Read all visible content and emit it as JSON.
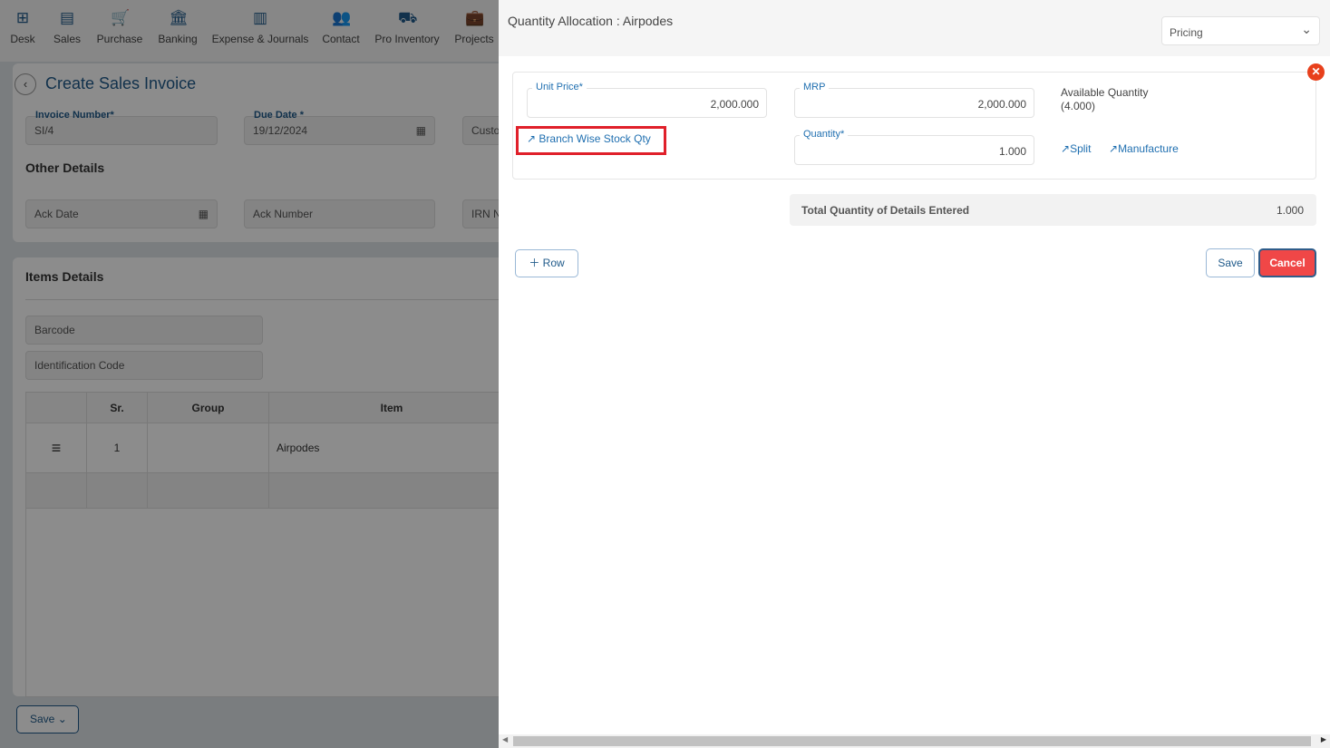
{
  "nav": [
    {
      "label": "Desk",
      "icon": "grid-plus-icon"
    },
    {
      "label": "Sales",
      "icon": "receipt-icon"
    },
    {
      "label": "Purchase",
      "icon": "cart-icon"
    },
    {
      "label": "Banking",
      "icon": "bank-icon"
    },
    {
      "label": "Expense & Journals",
      "icon": "journal-icon"
    },
    {
      "label": "Contact",
      "icon": "contacts-icon"
    },
    {
      "label": "Pro Inventory",
      "icon": "inventory-icon"
    },
    {
      "label": "Projects",
      "icon": "projects-icon"
    }
  ],
  "page": {
    "title": "Create Sales Invoice",
    "invoice_number_label": "Invoice Number*",
    "invoice_number": "SI/4",
    "due_date_label": "Due Date *",
    "due_date": "19/12/2024",
    "customer_placeholder": "Custo",
    "other_details": "Other Details",
    "ack_date": "Ack Date",
    "ack_number": "Ack Number",
    "irn": "IRN N",
    "items_details": "Items Details",
    "barcode": "Barcode",
    "identification_code": "Identification Code",
    "table": {
      "headers": [
        "",
        "Sr.",
        "Group",
        "Item"
      ],
      "rows": [
        {
          "sr": "1",
          "group": "",
          "item": "Airpodes"
        }
      ]
    },
    "save": "Save"
  },
  "panel": {
    "title": "Quantity Allocation : Airpodes",
    "select": "Pricing",
    "unit_price_label": "Unit Price*",
    "unit_price": "2,000.000",
    "mrp_label": "MRP",
    "mrp": "2,000.000",
    "available_label": "Available Quantity",
    "available": "(4.000)",
    "branch_link": "Branch Wise Stock Qty",
    "quantity_label": "Quantity*",
    "quantity": "1.000",
    "split": "Split",
    "manufacture": "Manufacture",
    "total_label": "Total Quantity of Details Entered",
    "total": "1.000",
    "row_btn": "Row",
    "save": "Save",
    "cancel": "Cancel"
  },
  "colors": {
    "accent": "#1f6fb0",
    "cancel": "#f04747",
    "highlight": "#e0202a"
  }
}
